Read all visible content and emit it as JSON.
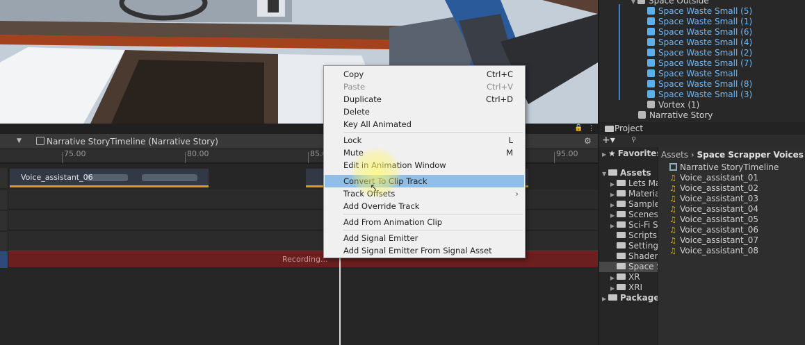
{
  "hierarchy": {
    "parent": "Space Outside",
    "children": [
      "Space Waste Small (5)",
      "Space Waste Small (1)",
      "Space Waste Small (6)",
      "Space Waste Small (4)",
      "Space Waste Small (2)",
      "Space Waste Small (7)",
      "Space Waste Small",
      "Space Waste Small (8)",
      "Space Waste Small (3)"
    ],
    "vortex": "Vortex (1)",
    "narrative": "Narrative Story"
  },
  "timeline": {
    "title": "Narrative StoryTimeline (Narrative Story)",
    "ruler": [
      "75.00",
      "80.00",
      "85.0",
      "95.00"
    ],
    "clip1_label": "Voice_assistant_06",
    "recording": "Recording..."
  },
  "context_menu": {
    "copy": {
      "label": "Copy",
      "shortcut": "Ctrl+C"
    },
    "paste": {
      "label": "Paste",
      "shortcut": "Ctrl+V"
    },
    "duplicate": {
      "label": "Duplicate",
      "shortcut": "Ctrl+D"
    },
    "delete": {
      "label": "Delete"
    },
    "key_all": {
      "label": "Key All Animated"
    },
    "lock": {
      "label": "Lock",
      "shortcut": "L"
    },
    "mute": {
      "label": "Mute",
      "shortcut": "M"
    },
    "edit_anim": {
      "label": "Edit in Animation Window"
    },
    "convert": {
      "label": "Convert To Clip Track"
    },
    "track_offsets": {
      "label": "Track Offsets",
      "submenu": "›"
    },
    "add_override": {
      "label": "Add Override Track"
    },
    "add_from_clip": {
      "label": "Add From Animation Clip"
    },
    "add_signal": {
      "label": "Add Signal Emitter"
    },
    "add_signal_asset": {
      "label": "Add Signal Emitter From Signal Asset"
    }
  },
  "project": {
    "tab": "Project",
    "favorites": "Favorites",
    "breadcrumb_root": "Assets",
    "breadcrumb_sep": "›",
    "breadcrumb_leaf": "Space Scrapper Voices",
    "assets_root": "Assets",
    "folders": [
      "Lets Ma",
      "Materia",
      "Sample",
      "Scenes",
      "Sci-Fi S",
      "Scripts",
      "Setting:",
      "Shader:",
      "Space S",
      "XR",
      "XRI"
    ],
    "packages": "Packages",
    "files": [
      "Narrative StoryTimeline",
      "Voice_assistant_01",
      "Voice_assistant_02",
      "Voice_assistant_03",
      "Voice_assistant_04",
      "Voice_assistant_05",
      "Voice_assistant_06",
      "Voice_assistant_07",
      "Voice_assistant_08"
    ]
  }
}
